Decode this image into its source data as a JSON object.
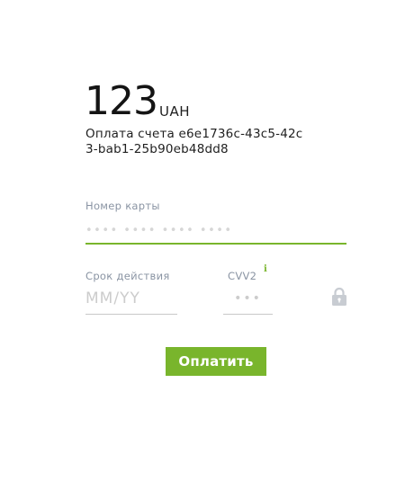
{
  "payment": {
    "amount": "123",
    "currency": "UAH",
    "description": "Оплата счета e6e1736c-43c5-42c3-bab1-25b90eb48dd8"
  },
  "card_number": {
    "label": "Номер карты",
    "placeholder": "•••• •••• •••• ••••",
    "value": ""
  },
  "expiry": {
    "label": "Срок действия",
    "placeholder": "MM/YY",
    "value": ""
  },
  "cvv": {
    "label": "CVV2",
    "info_glyph": "i",
    "placeholder": "•••",
    "value": ""
  },
  "icons": {
    "info": "info-icon",
    "lock": "lock-icon"
  },
  "submit": {
    "label": "Оплатить"
  },
  "colors": {
    "accent": "#79b52c",
    "label": "#8a94a3",
    "text": "#1f1f1f",
    "muted_icon": "#c8ccd2"
  }
}
